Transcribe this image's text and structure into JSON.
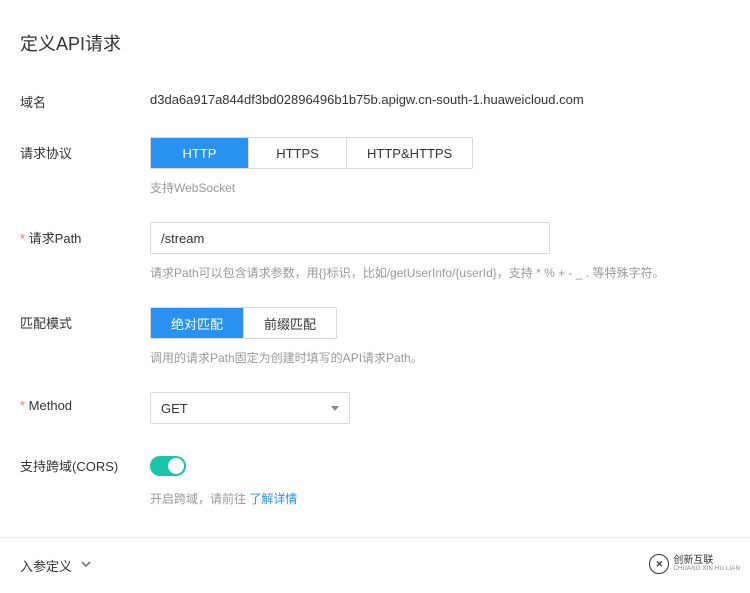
{
  "title": "定义API请求",
  "fields": {
    "domain": {
      "label": "域名",
      "value": "d3da6a917a844df3bd02896496b1b75b.apigw.cn-south-1.huaweicloud.com"
    },
    "protocol": {
      "label": "请求协议",
      "options": [
        "HTTP",
        "HTTPS",
        "HTTP&HTTPS"
      ],
      "selected": "HTTP",
      "hint": "支持WebSocket"
    },
    "path": {
      "label": "请求Path",
      "value": "/stream",
      "hint": "请求Path可以包含请求参数，用{}标识，比如/getUserInfo/{userId}，支持 * % + - _ . 等特殊字符。"
    },
    "matchMode": {
      "label": "匹配模式",
      "options": [
        "绝对匹配",
        "前缀匹配"
      ],
      "selected": "绝对匹配",
      "hint": "调用的请求Path固定为创建时填写的API请求Path。"
    },
    "method": {
      "label": "Method",
      "value": "GET"
    },
    "cors": {
      "label": "支持跨域(CORS)",
      "enabled": true,
      "hintPrefix": "开启跨域，请前往 ",
      "hintLink": "了解详情"
    }
  },
  "paramSection": {
    "label": "入参定义"
  },
  "footer": {
    "brandCn": "创新互联",
    "brandEn": "CHUANG XIN HU LIAN"
  }
}
